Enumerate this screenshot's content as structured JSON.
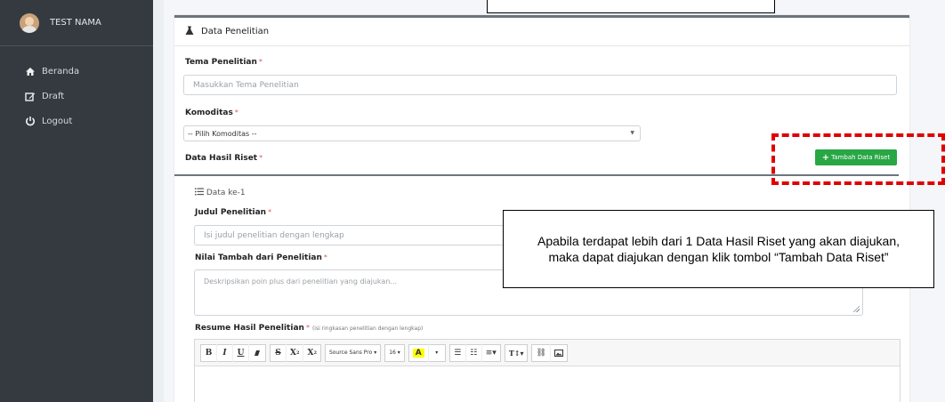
{
  "sidebar": {
    "user_name": "TEST NAMA",
    "items": [
      {
        "label": "Beranda",
        "icon": "home-icon",
        "glyph": "🏠"
      },
      {
        "label": "Draft",
        "icon": "edit-icon",
        "glyph": "✎"
      },
      {
        "label": "Logout",
        "icon": "power-icon",
        "glyph": "⏻"
      }
    ]
  },
  "card": {
    "title": "Data Penelitian",
    "tema_label": "Tema Penelitian",
    "tema_placeholder": "Masukkan Tema Penelitian",
    "komoditas_label": "Komoditas",
    "komoditas_value": "-- Pilih Komoditas --",
    "data_hasil_label": "Data Hasil Riset",
    "add_button_label": "Tambah Data Riset"
  },
  "subcard": {
    "title": "Data ke-1",
    "judul_label": "Judul Penelitian",
    "judul_placeholder": "Isi judul penelitian dengan lengkap",
    "nilai_label": "Nilai Tambah dari Penelitian",
    "nilai_placeholder": "Deskripsikan poin plus dari penelitian yang diajukan...",
    "resume_label": "Resume Hasil Penelitian",
    "resume_note": "(isi ringkasan penelitian dengan lengkap)"
  },
  "editor": {
    "font_name": "Source Sans Pro",
    "font_size": "16"
  },
  "required_mark": "*",
  "callout_text": "Apabila terdapat lebih dari 1 Data Hasil Riset yang akan diajukan, maka dapat diajukan dengan klik tombol “Tambah Data Riset”",
  "colors": {
    "sidebar_bg": "#343a40",
    "add_button": "#28a745",
    "highlight_dash": "#e00000"
  }
}
